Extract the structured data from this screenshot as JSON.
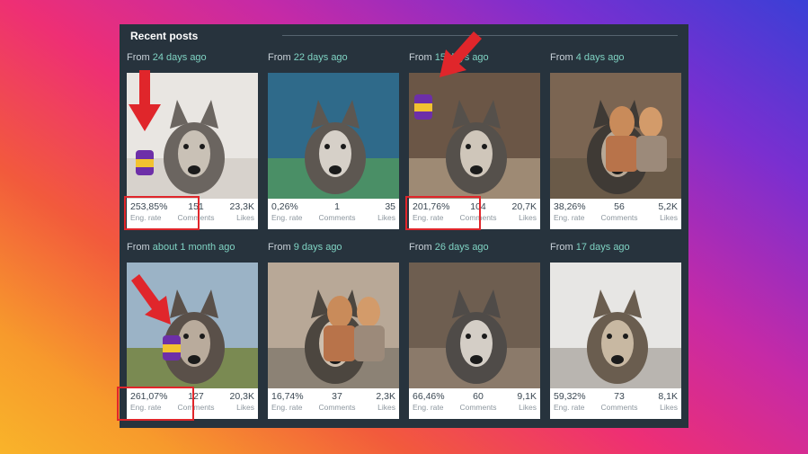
{
  "panel": {
    "title": "Recent posts"
  },
  "posts": [
    {
      "from": "From",
      "when": "24 days ago",
      "eng": "253,85%",
      "comments": "151",
      "likes": "23,3K"
    },
    {
      "from": "From",
      "when": "22 days ago",
      "eng": "0,26%",
      "comments": "1",
      "likes": "35"
    },
    {
      "from": "From",
      "when": "15 days ago",
      "eng": "201,76%",
      "comments": "104",
      "likes": "20,7K"
    },
    {
      "from": "From",
      "when": "4 days ago",
      "eng": "38,26%",
      "comments": "56",
      "likes": "5,2K"
    },
    {
      "from": "From",
      "when": "about 1 month ago",
      "eng": "261,07%",
      "comments": "127",
      "likes": "20,3K"
    },
    {
      "from": "From",
      "when": "9 days ago",
      "eng": "16,74%",
      "comments": "37",
      "likes": "2,3K"
    },
    {
      "from": "From",
      "when": "26 days ago",
      "eng": "66,46%",
      "comments": "60",
      "likes": "9,1K"
    },
    {
      "from": "From",
      "when": "17 days ago",
      "eng": "59,32%",
      "comments": "73",
      "likes": "8,1K"
    }
  ],
  "labels": {
    "eng": "Eng. rate",
    "comments": "Comments",
    "likes": "Likes"
  },
  "colors": {
    "panel": "#27333d",
    "accent": "#7fd3c3",
    "highlight": "#e0262b"
  }
}
